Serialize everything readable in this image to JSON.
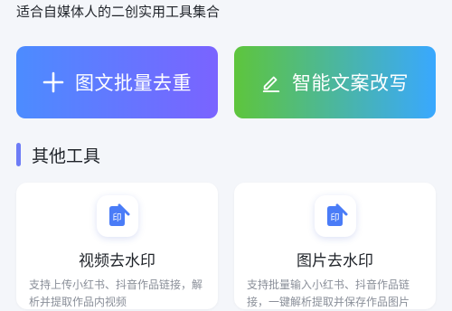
{
  "header": {
    "subtitle": "适合自媒体人的二创实用工具集合"
  },
  "actions": [
    {
      "label": "图文批量去重",
      "icon": "plus-icon"
    },
    {
      "label": "智能文案改写",
      "icon": "pen-icon"
    }
  ],
  "section": {
    "title": "其他工具"
  },
  "tools": [
    {
      "title": "视频去水印",
      "desc": "支持上传小红书、抖音作品链接，解析并提取作品内视频",
      "icon": "watermark-icon",
      "icon_text": "印"
    },
    {
      "title": "图片去水印",
      "desc": "支持批量输入小红书、抖音作品链接，一键解析提取并保存作品图片",
      "icon": "watermark-icon",
      "icon_text": "印"
    }
  ],
  "colors": {
    "accent_blue": "#4c8cff",
    "accent_purple": "#7a63ff",
    "accent_green": "#5ec53c",
    "section_bar": "#6d7cf6"
  }
}
